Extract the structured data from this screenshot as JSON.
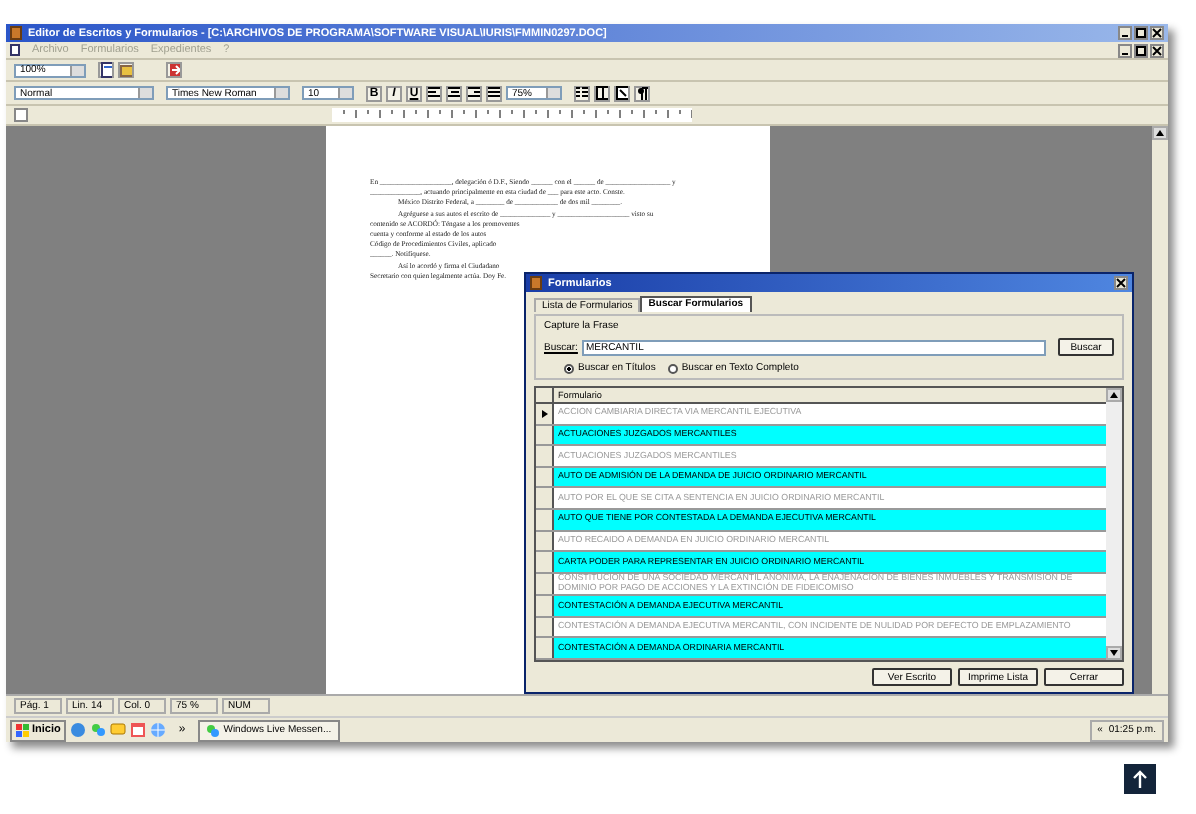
{
  "window": {
    "title": "Editor de Escritos y Formularios - [C:\\ARCHIVOS DE PROGRAMA\\SOFTWARE VISUAL\\IURIS\\FMMIN0297.DOC]"
  },
  "menu": [
    {
      "label": "Archivo",
      "disabled": true
    },
    {
      "label": "Formularios",
      "disabled": true
    },
    {
      "label": "Expedientes",
      "disabled": true
    },
    {
      "label": "?",
      "disabled": true
    }
  ],
  "toolbar": {
    "zoom": "100%"
  },
  "format_bar": {
    "style": "Normal",
    "font": "Times New Roman",
    "size": "10",
    "bold": "B",
    "italic": "I",
    "underline": "U",
    "zoom": "75%"
  },
  "document": {
    "lines": [
      {
        "text": "En ____________________, delegación ó D.F., Siendo ______ con el ______ de __________________ y",
        "indent": false
      },
      {
        "text": "______________, actuando principalmente en esta ciudad de ___ para este acto. Conste.",
        "indent": false
      },
      {
        "text": "México Distrito Federal, a ________ de ____________ de dos mil ________.",
        "indent": true
      },
      {
        "text": "Agréguese a sus autos el escrito de ______________ y ____________________ visto su",
        "indent": true
      },
      {
        "text": "contenido se ACORDÓ: Téngase a los promoventes",
        "indent": false
      },
      {
        "text": "cuenta y conforme al estado de los autos",
        "indent": false
      },
      {
        "text": "Código de Procedimientos Civiles, aplicado",
        "indent": false
      },
      {
        "text": "______. Notifíquese.",
        "indent": false
      },
      {
        "text": "Así lo acordó y firma el Ciudadano",
        "indent": true
      },
      {
        "text": "Secretario con quien legalmente actúa. Doy Fe.",
        "indent": false
      }
    ]
  },
  "dialog": {
    "title": "Formularios",
    "tabs": [
      {
        "label": "Lista de Formularios",
        "selected": false
      },
      {
        "label": "Buscar Formularios",
        "selected": true
      }
    ],
    "group_title": "Capture la Frase",
    "search_label": "Buscar:",
    "search_value": "MERCANTIL",
    "search_button": "Buscar",
    "options": [
      {
        "label": "Buscar en Títulos",
        "selected": true
      },
      {
        "label": "Buscar en Texto Completo",
        "selected": false
      }
    ],
    "column": "Formulario",
    "rows": [
      {
        "text": "ACCION CAMBIARIA DIRECTA VIA MERCANTIL EJECUTIVA",
        "highlighted": false,
        "current": true
      },
      {
        "text": "ACTUACIONES JUZGADOS MERCANTILES",
        "highlighted": true,
        "current": false
      },
      {
        "text": "ACTUACIONES JUZGADOS MERCANTILES",
        "highlighted": false,
        "current": false
      },
      {
        "text": "AUTO DE ADMISIÓN DE LA DEMANDA DE JUICIO ORDINARIO MERCANTIL",
        "highlighted": true,
        "current": false
      },
      {
        "text": "AUTO POR EL QUE SE CITA A SENTENCIA EN JUICIO ORDINARIO MERCANTIL",
        "highlighted": false,
        "current": false
      },
      {
        "text": "AUTO QUE TIENE POR CONTESTADA LA DEMANDA EJECUTIVA MERCANTIL",
        "highlighted": true,
        "current": false
      },
      {
        "text": "AUTO RECAIDO A DEMANDA EN JUICIO ORDINARIO MERCANTIL",
        "highlighted": false,
        "current": false
      },
      {
        "text": "CARTA PODER PARA REPRESENTAR EN JUICIO ORDINARIO MERCANTIL",
        "highlighted": true,
        "current": false
      },
      {
        "text": "CONSTITUCIÓN DE UNA SOCIEDAD MERCANTIL ANÓNIMA, LA ENAJENACIÓN DE BIENES INMUEBLES Y TRANSMISIÓN DE DOMINIO POR PAGO DE ACCIONES Y LA EXTINCIÓN DE FIDEICOMISO",
        "highlighted": false,
        "current": false
      },
      {
        "text": "CONTESTACIÓN A DEMANDA EJECUTIVA MERCANTIL",
        "highlighted": true,
        "current": false
      },
      {
        "text": "CONTESTACIÓN A DEMANDA EJECUTIVA MERCANTIL, CON INCIDENTE DE NULIDAD POR DEFECTO DE EMPLAZAMIENTO",
        "highlighted": false,
        "current": false
      },
      {
        "text": "CONTESTACIÓN A DEMANDA ORDINARIA MERCANTIL",
        "highlighted": true,
        "current": false
      }
    ],
    "buttons": [
      "Ver Escrito",
      "Imprime Lista",
      "Cerrar"
    ]
  },
  "status_bar": [
    "Pág. 1",
    "Lin. 14",
    "Col. 0",
    "75 %",
    "NUM"
  ],
  "taskbar": {
    "start": "Inicio",
    "more": "»",
    "task": "Windows Live Messen...",
    "tray_toggle": "«",
    "clock": "01:25 p.m."
  }
}
